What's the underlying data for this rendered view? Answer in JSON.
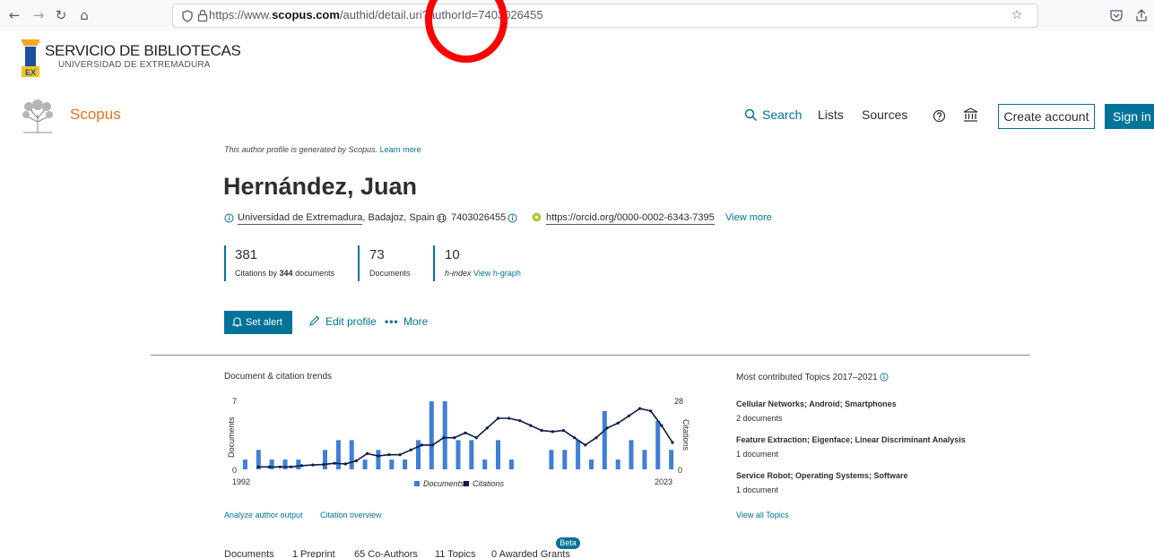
{
  "browser": {
    "url_prefix": "https://www.",
    "url_domain": "scopus.com",
    "url_path": "/authid/detail.uri?authorId=7403026455"
  },
  "library": {
    "title": "SERVICIO DE BIBLIOTECAS",
    "subtitle": "UNIVERSIDAD DE EXTREMADURA",
    "logo_letters": "EX"
  },
  "header": {
    "brand": "Scopus",
    "nav": {
      "search": "Search",
      "lists": "Lists",
      "sources": "Sources"
    },
    "create_account": "Create account",
    "sign_in": "Sign in"
  },
  "profile": {
    "generated_note": "This author profile is generated by Scopus.",
    "learn_more": "Learn more",
    "name": "Hernández, Juan",
    "affiliation": "Universidad de Extremadura",
    "location": ", Badajoz, Spain",
    "author_id": "7403026455",
    "orcid_url": "https://orcid.org/0000-0002-6343-7395",
    "view_more": "View more",
    "metrics": {
      "citations_value": "381",
      "citations_label_prefix": "Citations by ",
      "citations_label_bold": "344",
      "citations_label_suffix": " documents",
      "documents_value": "73",
      "documents_label": "Documents",
      "hindex_value": "10",
      "hindex_label": "h-index",
      "hindex_link": "View h-graph"
    },
    "actions": {
      "set_alert": "Set alert",
      "edit_profile": "Edit profile",
      "more": "More"
    }
  },
  "chart_section": {
    "title": "Document & citation trends",
    "analyze_link": "Analyze author output",
    "citation_overview_link": "Citation overview"
  },
  "chart_data": {
    "type": "bar",
    "x_start": "1992",
    "x_end": "2023",
    "ylabel_left": "Documents",
    "ylabel_right": "Citations",
    "ylim_left": [
      0,
      7
    ],
    "ylim_right": [
      0,
      28
    ],
    "left_ticks": [
      "7",
      "0"
    ],
    "right_ticks": [
      "28",
      "0"
    ],
    "series": [
      {
        "name": "Documents",
        "kind": "bar",
        "color": "#3f7fd6",
        "values": [
          1,
          2,
          1,
          1,
          1,
          0,
          2,
          3,
          3,
          1,
          2,
          1,
          1,
          3,
          7,
          7,
          3,
          3,
          1,
          3,
          1,
          0,
          0,
          2,
          2,
          3,
          1,
          6,
          1,
          3,
          2,
          5,
          2
        ]
      },
      {
        "name": "Citations",
        "kind": "line",
        "color": "#0c1a4d",
        "values": [
          1,
          1,
          1,
          1,
          1.5,
          1.8,
          2,
          2.5,
          2.2,
          3.5,
          6.5,
          5.5,
          6,
          6,
          8,
          10,
          10,
          13,
          13,
          15,
          13,
          17,
          21,
          21,
          20,
          18,
          16,
          15.5,
          16,
          13,
          10,
          13,
          17,
          19,
          22,
          25,
          24,
          18,
          11
        ]
      }
    ],
    "legend": [
      "Documents",
      "Citations"
    ],
    "legend_position": "bottom"
  },
  "topics": {
    "title": "Most contributed Topics 2017–2021",
    "items": [
      {
        "name": "Cellular Networks; Android; Smartphones",
        "count": "2 documents"
      },
      {
        "name": "Feature Extraction; Eigenface; Linear Discriminant Analysis",
        "count": "1 document"
      },
      {
        "name": "Service Robot; Operating Systems; Software",
        "count": "1 document"
      }
    ],
    "view_all": "View all Topics"
  },
  "tabs": {
    "documents": "Documents",
    "preprint": "1 Preprint",
    "coauthors": "65 Co-Authors",
    "topics": "11 Topics",
    "grants": "0 Awarded Grants",
    "beta": "Beta"
  },
  "colors": {
    "accent": "#007398",
    "brand_orange": "#e9711c",
    "bar": "#3f7fd6",
    "line": "#0c1a4d",
    "annotation": "#ff0000"
  }
}
